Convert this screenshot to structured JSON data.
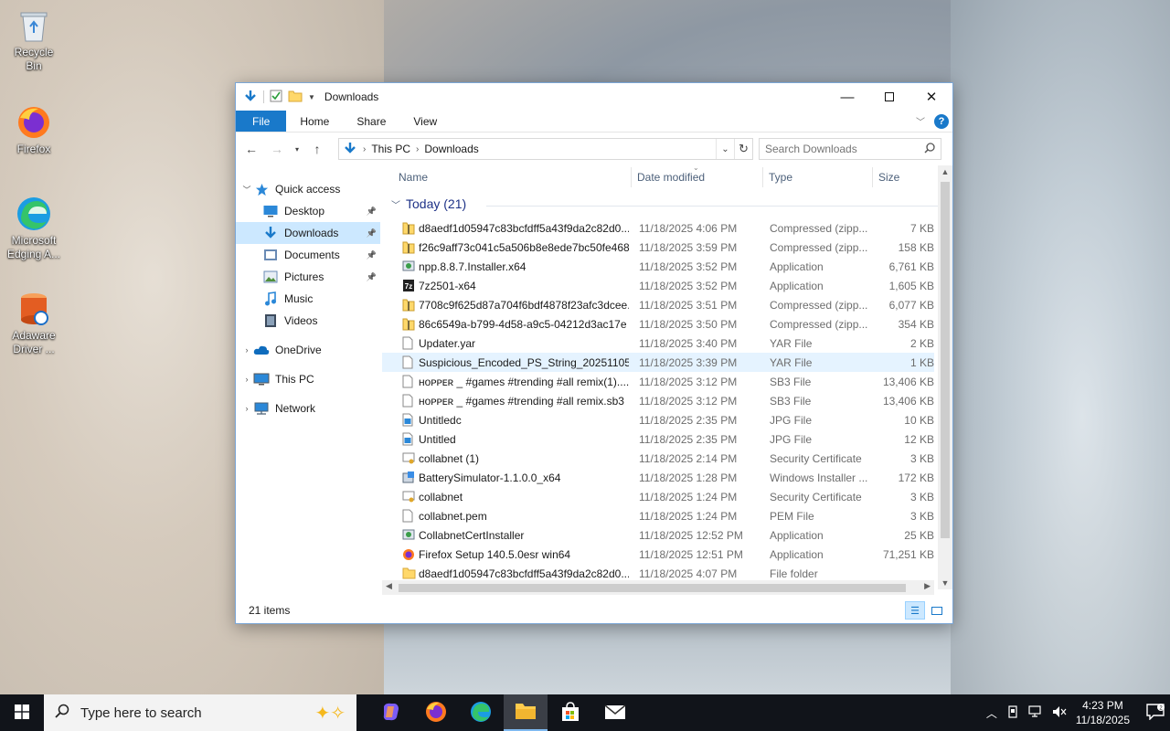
{
  "desktop": {
    "icons": [
      {
        "label": "Recycle Bin"
      },
      {
        "label": "Firefox"
      },
      {
        "label": "Microsoft Edging A..."
      },
      {
        "label": "Adaware Driver ..."
      }
    ]
  },
  "window": {
    "title": "Downloads",
    "ribbon_tabs": [
      "File",
      "Home",
      "Share",
      "View"
    ],
    "address": {
      "crumbs": [
        "This PC",
        "Downloads"
      ]
    },
    "search_placeholder": "Search Downloads",
    "nav": [
      {
        "label": "Quick access",
        "icon": "star-icon"
      },
      {
        "label": "Desktop",
        "icon": "desktop-icon",
        "pinned": true
      },
      {
        "label": "Downloads",
        "icon": "download-icon",
        "pinned": true,
        "selected": true
      },
      {
        "label": "Documents",
        "icon": "document-icon",
        "pinned": true
      },
      {
        "label": "Pictures",
        "icon": "picture-icon",
        "pinned": true
      },
      {
        "label": "Music",
        "icon": "music-icon"
      },
      {
        "label": "Videos",
        "icon": "video-icon"
      },
      {
        "label": "OneDrive",
        "icon": "cloud-icon"
      },
      {
        "label": "This PC",
        "icon": "pc-icon"
      },
      {
        "label": "Network",
        "icon": "network-icon"
      }
    ],
    "columns": [
      "Name",
      "Date modified",
      "Type",
      "Size"
    ],
    "group_label": "Today (21)",
    "files": [
      {
        "name": "d8aedf1d05947c83bcfdff5a43f9da2c82d0...",
        "date": "11/18/2025 4:06 PM",
        "type": "Compressed (zipp...",
        "size": "7 KB",
        "icon": "zip"
      },
      {
        "name": "f26c9aff73c041c5a506b8e8ede7bc50fe468...",
        "date": "11/18/2025 3:59 PM",
        "type": "Compressed (zipp...",
        "size": "158 KB",
        "icon": "zip"
      },
      {
        "name": "npp.8.8.7.Installer.x64",
        "date": "11/18/2025 3:52 PM",
        "type": "Application",
        "size": "6,761 KB",
        "icon": "app"
      },
      {
        "name": "7z2501-x64",
        "date": "11/18/2025 3:52 PM",
        "type": "Application",
        "size": "1,605 KB",
        "icon": "sevenzip"
      },
      {
        "name": "7708c9f625d87a704f6bdf4878f23afc3dcee...",
        "date": "11/18/2025 3:51 PM",
        "type": "Compressed (zipp...",
        "size": "6,077 KB",
        "icon": "zip"
      },
      {
        "name": "86c6549a-b799-4d58-a9c5-04212d3ac17e",
        "date": "11/18/2025 3:50 PM",
        "type": "Compressed (zipp...",
        "size": "354 KB",
        "icon": "zip"
      },
      {
        "name": "Updater.yar",
        "date": "11/18/2025 3:40 PM",
        "type": "YAR File",
        "size": "2 KB",
        "icon": "file"
      },
      {
        "name": "Suspicious_Encoded_PS_String_20251105....",
        "date": "11/18/2025 3:39 PM",
        "type": "YAR File",
        "size": "1 KB",
        "icon": "file",
        "hover": true
      },
      {
        "name": "ʜᴏᴘᴘᴇʀ _ #games #trending #all remix(1)....",
        "date": "11/18/2025 3:12 PM",
        "type": "SB3 File",
        "size": "13,406 KB",
        "icon": "file"
      },
      {
        "name": "ʜᴏᴘᴘᴇʀ _ #games #trending #all remix.sb3",
        "date": "11/18/2025 3:12 PM",
        "type": "SB3 File",
        "size": "13,406 KB",
        "icon": "file"
      },
      {
        "name": "Untitledc",
        "date": "11/18/2025 2:35 PM",
        "type": "JPG File",
        "size": "10 KB",
        "icon": "image"
      },
      {
        "name": "Untitled",
        "date": "11/18/2025 2:35 PM",
        "type": "JPG File",
        "size": "12 KB",
        "icon": "image"
      },
      {
        "name": "collabnet (1)",
        "date": "11/18/2025 2:14 PM",
        "type": "Security Certificate",
        "size": "3 KB",
        "icon": "cert"
      },
      {
        "name": "BatterySimulator-1.1.0.0_x64",
        "date": "11/18/2025 1:28 PM",
        "type": "Windows Installer ...",
        "size": "172 KB",
        "icon": "msi"
      },
      {
        "name": "collabnet",
        "date": "11/18/2025 1:24 PM",
        "type": "Security Certificate",
        "size": "3 KB",
        "icon": "cert"
      },
      {
        "name": "collabnet.pem",
        "date": "11/18/2025 1:24 PM",
        "type": "PEM File",
        "size": "3 KB",
        "icon": "file"
      },
      {
        "name": "CollabnetCertInstaller",
        "date": "11/18/2025 12:52 PM",
        "type": "Application",
        "size": "25 KB",
        "icon": "app"
      },
      {
        "name": "Firefox Setup 140.5.0esr win64",
        "date": "11/18/2025 12:51 PM",
        "type": "Application",
        "size": "71,251 KB",
        "icon": "firefox"
      },
      {
        "name": "d8aedf1d05947c83bcfdff5a43f9da2c82d0...",
        "date": "11/18/2025 4:07 PM",
        "type": "File folder",
        "size": "",
        "icon": "folder"
      }
    ],
    "status_text": "21 items"
  },
  "taskbar": {
    "search_placeholder": "Type here to search",
    "time": "4:23 PM",
    "date": "11/18/2025"
  },
  "colors": {
    "accent": "#1979ca",
    "selection": "#cce8ff",
    "hover": "#e5f3ff",
    "taskbar": "#11141a"
  }
}
